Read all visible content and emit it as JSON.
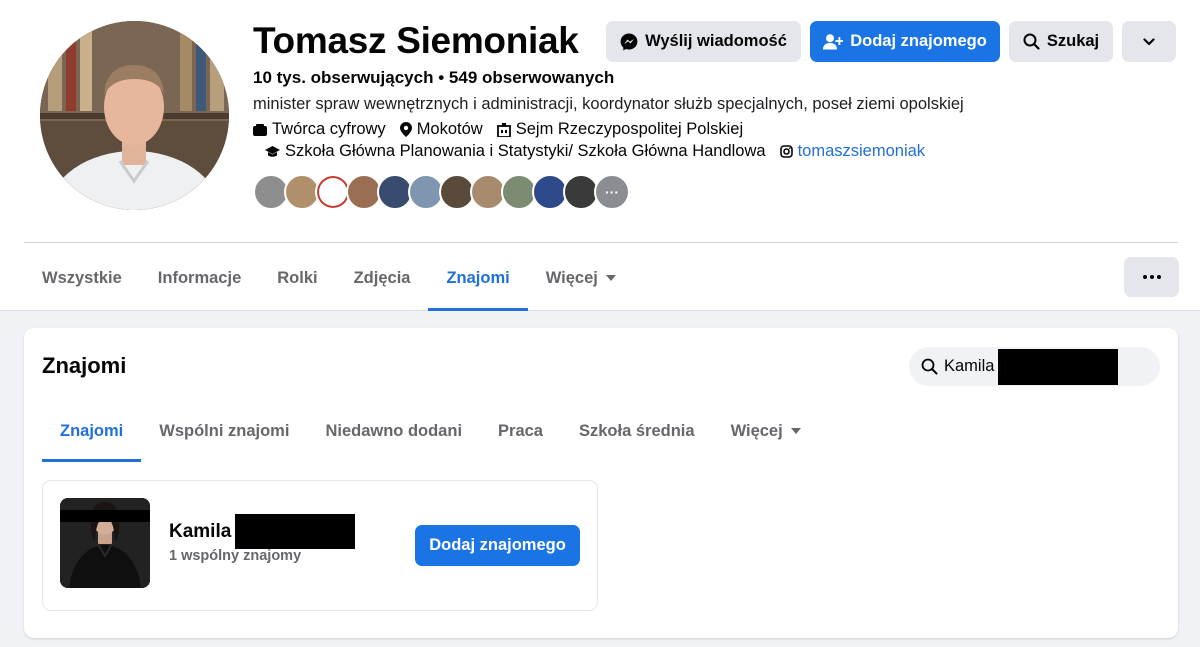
{
  "profile": {
    "name": "Tomasz Siemoniak",
    "followers": "10 tys. obserwujących",
    "separator": "•",
    "following": "549 obserwowanych",
    "bio": "minister spraw wewnętrznych i administracji, koordynator służb specjalnych, poseł ziemi opolskiej",
    "creator": "Twórca cyfrowy",
    "location": "Mokotów",
    "work": "Sejm Rzeczypospolitej Polskiej",
    "education": "Szkoła Główna Planowania i Statystyki/ Szkoła Główna Handlowa",
    "instagram": "tomaszsiemoniak",
    "mutual_more": "···"
  },
  "actions": {
    "message": "Wyślij wiadomość",
    "add_friend": "Dodaj znajomego",
    "search": "Szukaj"
  },
  "profile_tabs": [
    {
      "label": "Wszystkie"
    },
    {
      "label": "Informacje"
    },
    {
      "label": "Rolki"
    },
    {
      "label": "Zdjęcia"
    },
    {
      "label": "Znajomi"
    },
    {
      "label": "Więcej"
    }
  ],
  "friends_section": {
    "title": "Znajomi",
    "search_value": "Kamila",
    "tabs": [
      {
        "label": "Znajomi"
      },
      {
        "label": "Wspólni znajomi"
      },
      {
        "label": "Niedawno dodani"
      },
      {
        "label": "Praca"
      },
      {
        "label": "Szkoła średnia"
      },
      {
        "label": "Więcej"
      }
    ],
    "result": {
      "first_name": "Kamila",
      "mutual": "1 wspólny znajomy",
      "add_label": "Dodaj znajomego"
    }
  },
  "colors": {
    "accent": "#1b74e4",
    "link": "#216fdb",
    "page_bg": "#f0f2f5",
    "button_grey": "#e4e6eb"
  }
}
